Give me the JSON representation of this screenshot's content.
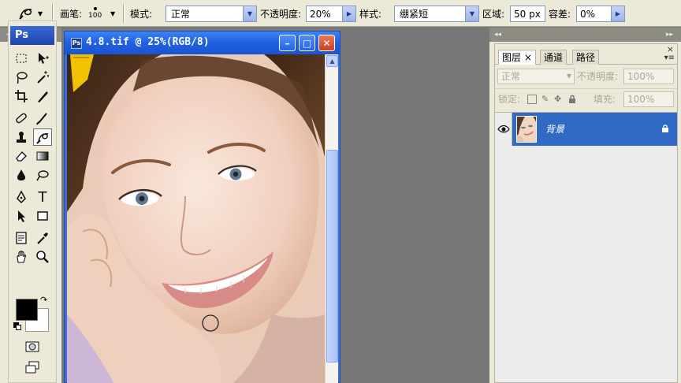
{
  "options_bar": {
    "brush_label": "画笔:",
    "brush_size": "100",
    "mode_label": "模式:",
    "mode_value": "正常",
    "opacity_label": "不透明度:",
    "opacity_value": "20%",
    "style_label": "样式:",
    "style_value": "绷紧短",
    "area_label": "区域:",
    "area_value": "50 px",
    "tolerance_label": "容差:",
    "tolerance_value": "0%"
  },
  "toolbox": {
    "logo": "Ps",
    "collapse_glyph": "◂◂",
    "foreground_color": "#000000",
    "background_color": "#ffffff",
    "text_tool_glyph": "T"
  },
  "document": {
    "title": "4.8.tif @ 25%(RGB/8)",
    "icon_label": "Ps",
    "minimize_glyph": "–",
    "maximize_glyph": "□",
    "close_glyph": "✕"
  },
  "layers_panel": {
    "tabs": [
      {
        "label": "图层 ×"
      },
      {
        "label": "通道"
      },
      {
        "label": "路径"
      }
    ],
    "blend_mode": "正常",
    "opacity_label": "不透明度:",
    "opacity_value": "100%",
    "lock_label": "锁定:",
    "fill_label": "填充:",
    "fill_value": "100%",
    "layers": [
      {
        "name": "背景"
      }
    ],
    "dock_collapse_glyph": "▸▸",
    "dock_left_glyph": "◂◂",
    "close_glyph": "×",
    "menu_glyph": "▾≡"
  },
  "colors": {
    "titlebar": "#2160e0",
    "selected_layer": "#316ac5",
    "chrome": "#ece9d8"
  }
}
